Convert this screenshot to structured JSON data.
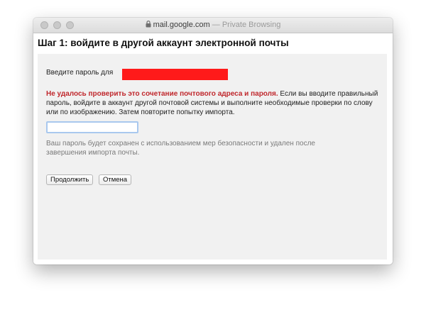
{
  "browser": {
    "url": "mail.google.com",
    "separator": " — ",
    "mode": "Private Browsing"
  },
  "page": {
    "title": "Шаг 1: войдите в другой аккаунт электронной почты",
    "password_prompt": "Введите пароль для",
    "error_bold": "Не удалось проверить это сочетание почтового адреса и пароля.",
    "error_text": " Если вы вводите правильный пароль, войдите в аккаунт другой почтовой системы и выполните необходимые проверки по слову или по изображению. Затем повторите попытку импорта.",
    "password_value": "",
    "security_note": "Ваш пароль будет сохранен с использованием мер безопасности и удален после завершения импорта почты."
  },
  "buttons": {
    "continue_label": "Продолжить",
    "cancel_label": "Отмена"
  },
  "colors": {
    "error_text": "#c0282d",
    "redaction": "#ff1a1a",
    "input_focus_border": "#a9c8ee",
    "panel_background": "#f1f1f1"
  },
  "icons": {
    "address_bar": "lock-icon"
  }
}
